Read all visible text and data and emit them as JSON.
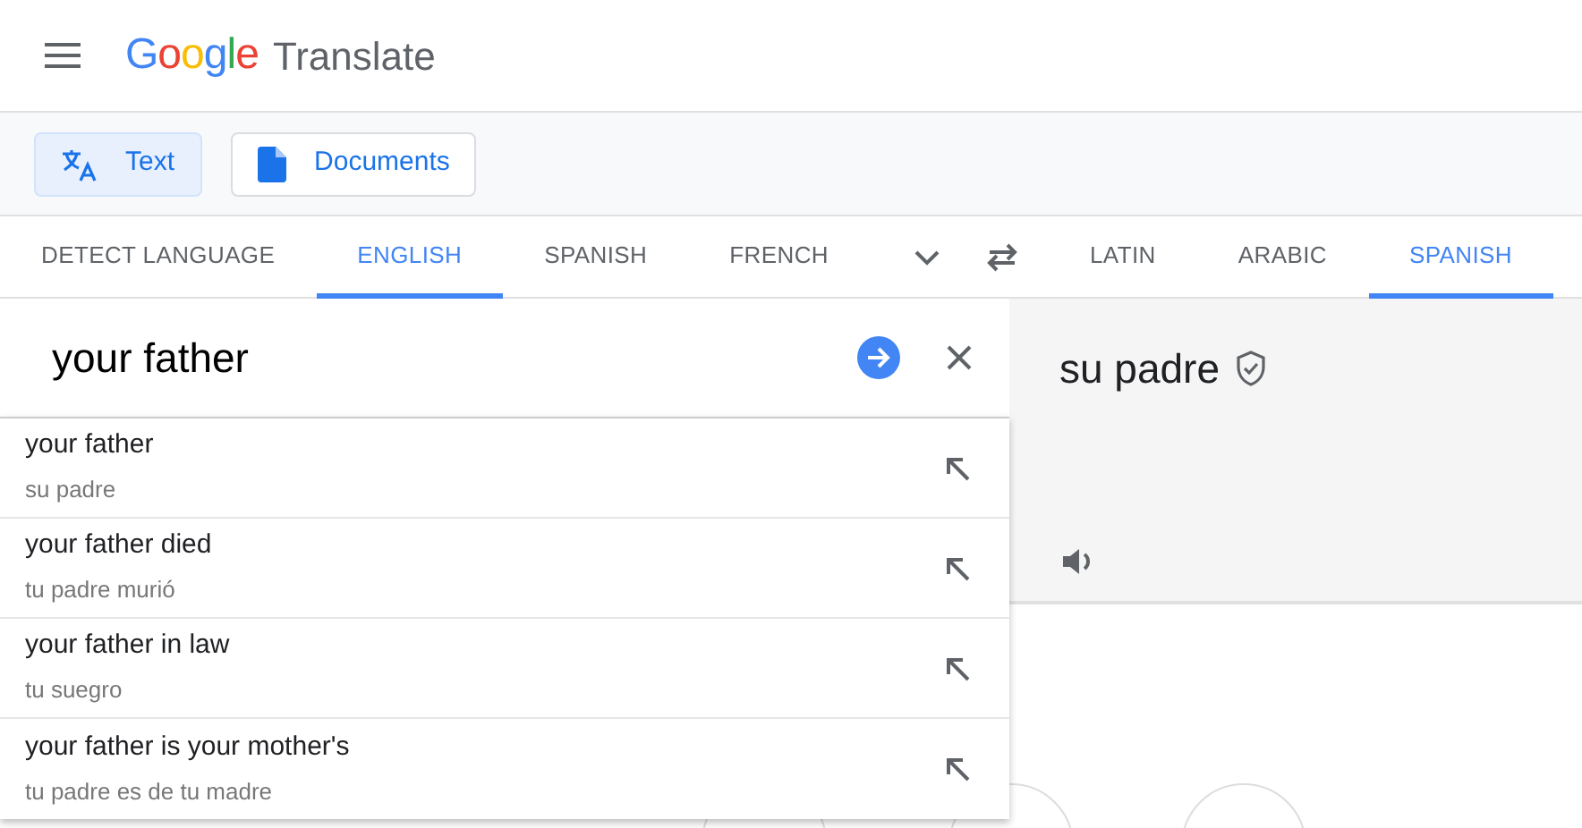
{
  "header": {
    "logo": "Google",
    "product": "Translate"
  },
  "modes": [
    {
      "label": "Text",
      "kind": "text",
      "selected": true
    },
    {
      "label": "Documents",
      "kind": "document",
      "selected": false
    }
  ],
  "source_languages": [
    {
      "label": "DETECT LANGUAGE",
      "selected": false
    },
    {
      "label": "ENGLISH",
      "selected": true
    },
    {
      "label": "SPANISH",
      "selected": false
    },
    {
      "label": "FRENCH",
      "selected": false
    }
  ],
  "target_languages": [
    {
      "label": "LATIN",
      "selected": false
    },
    {
      "label": "ARABIC",
      "selected": false
    },
    {
      "label": "SPANISH",
      "selected": true
    }
  ],
  "source": {
    "value": "your father"
  },
  "translation": {
    "text": "su padre",
    "verified": true
  },
  "suggestions": [
    {
      "text": "your father",
      "translation": "su padre"
    },
    {
      "text": "your father died",
      "translation": "tu padre murió"
    },
    {
      "text": "your father in law",
      "translation": "tu suegro"
    },
    {
      "text": "your father is your mother's",
      "translation": "tu padre es de tu madre"
    }
  ]
}
